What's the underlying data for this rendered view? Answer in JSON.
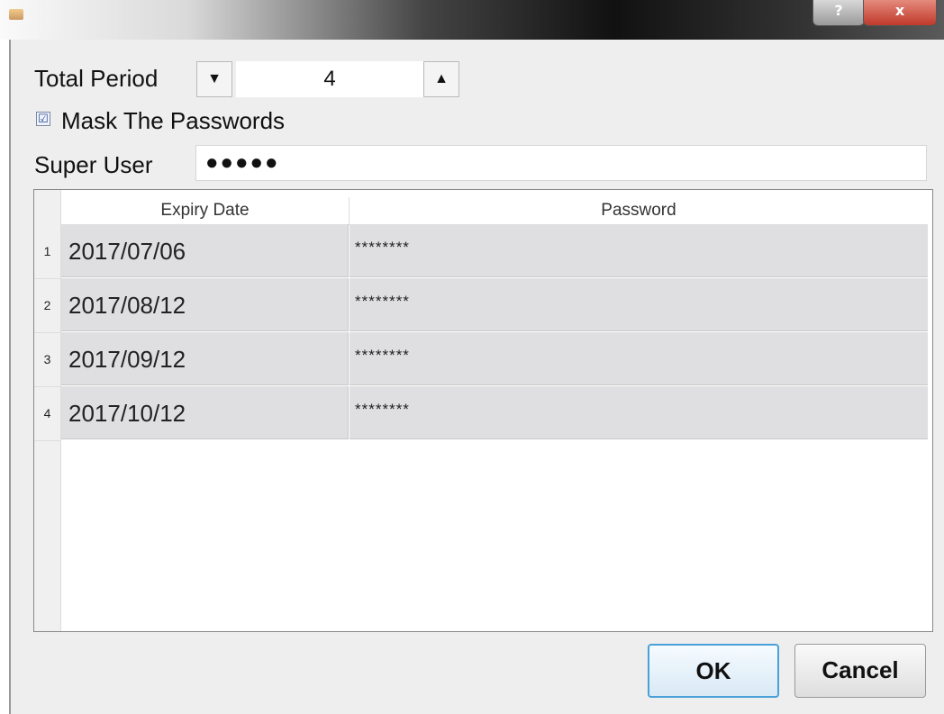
{
  "titlebar": {
    "help_label": "?",
    "close_label": "x"
  },
  "period": {
    "label": "Total Period",
    "value": "4",
    "decrement_icon": "▼",
    "increment_icon": "▲"
  },
  "mask": {
    "checked": true,
    "check_icon": "☑",
    "label": "Mask The Passwords"
  },
  "super_user": {
    "label": "Super User",
    "value": "●●●●●"
  },
  "table": {
    "columns": [
      "Expiry Date",
      "Password"
    ],
    "rows": [
      {
        "num": "1",
        "date": "2017/07/06",
        "password": "********"
      },
      {
        "num": "2",
        "date": "2017/08/12",
        "password": "********"
      },
      {
        "num": "3",
        "date": "2017/09/12",
        "password": "********"
      },
      {
        "num": "4",
        "date": "2017/10/12",
        "password": "********"
      }
    ]
  },
  "buttons": {
    "ok": "OK",
    "cancel": "Cancel"
  },
  "colors": {
    "accent": "#4aa0d8",
    "selected_row": "#dfdfe1"
  }
}
